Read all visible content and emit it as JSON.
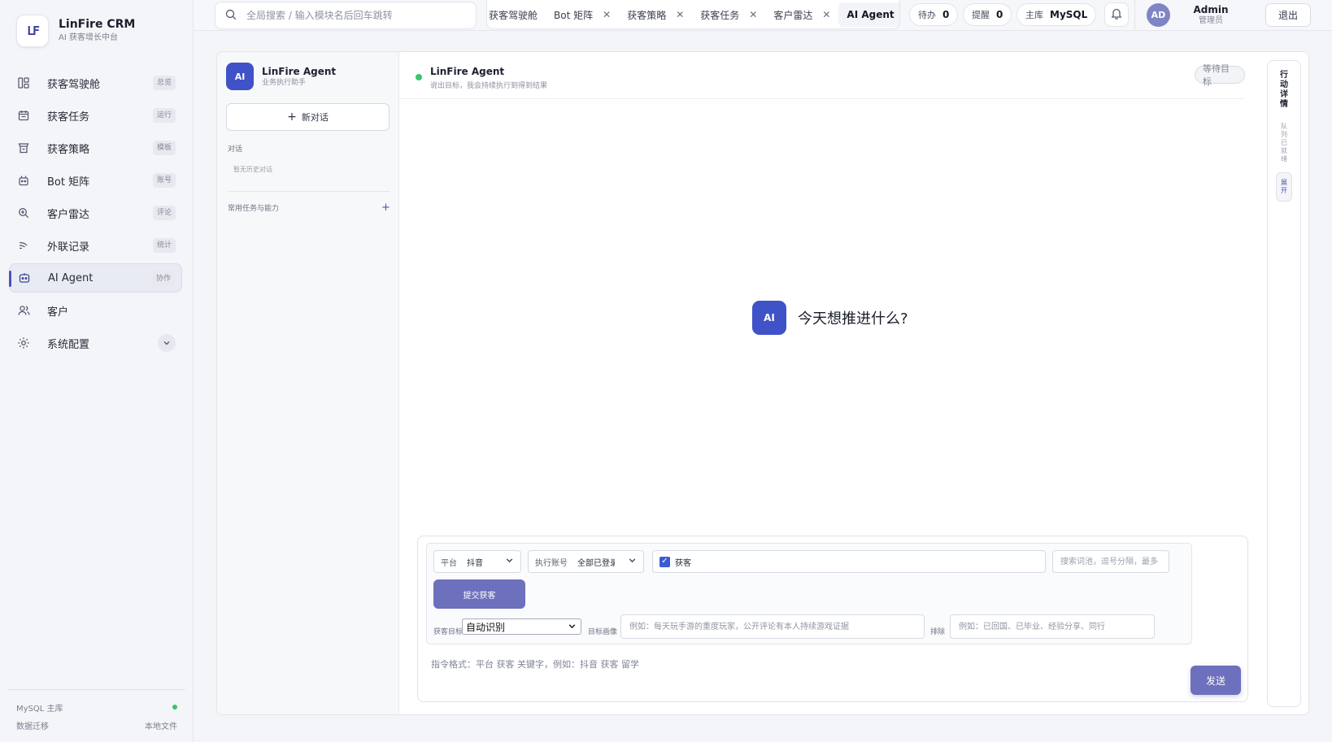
{
  "brand": {
    "title": "LinFire CRM",
    "subtitle": "AI 获客增长中台",
    "logo_text": "LF"
  },
  "sidebar": {
    "items": [
      {
        "label": "获客驾驶舱",
        "badge": "总览",
        "icon": "dashboard-icon"
      },
      {
        "label": "获客任务",
        "badge": "运行",
        "icon": "calendar-icon"
      },
      {
        "label": "获客策略",
        "badge": "模板",
        "icon": "filter-icon"
      },
      {
        "label": "Bot 矩阵",
        "badge": "账号",
        "icon": "bot-icon"
      },
      {
        "label": "客户雷达",
        "badge": "评论",
        "icon": "radar-search-icon"
      },
      {
        "label": "外联记录",
        "badge": "统计",
        "icon": "outreach-icon"
      },
      {
        "label": "AI Agent",
        "badge": "协作",
        "icon": "robot-icon",
        "active": true
      },
      {
        "label": "客户",
        "badge": "",
        "icon": "users-icon"
      }
    ],
    "config": {
      "label": "系统配置",
      "icon": "gear-icon"
    },
    "footer": {
      "db_label": "MySQL 主库",
      "migrate_label": "数据迁移",
      "local_label": "本地文件",
      "status_color": "#36c46a"
    }
  },
  "topbar": {
    "search_placeholder": "全局搜索 / 输入模块名后回车跳转",
    "tabs": [
      {
        "label": "获客驾驶舱",
        "closable": false
      },
      {
        "label": "Bot 矩阵",
        "closable": true
      },
      {
        "label": "获客策略",
        "closable": true
      },
      {
        "label": "获客任务",
        "closable": true
      },
      {
        "label": "客户雷达",
        "closable": true
      },
      {
        "label": "AI Agent",
        "closable": true,
        "active": true
      }
    ],
    "todo": {
      "label": "待办",
      "count": "0"
    },
    "remind": {
      "label": "提醒",
      "count": "0"
    },
    "db": {
      "label": "主库",
      "value": "MySQL"
    },
    "user": {
      "avatar": "AD",
      "name": "Admin",
      "role": "管理员"
    },
    "logout_label": "退出"
  },
  "conversations": {
    "agent_name": "LinFire Agent",
    "agent_sub": "业务执行助手",
    "ai_badge": "AI",
    "new_label": "新对话",
    "section_label": "对话",
    "empty_hint": "暂无历史对话",
    "capabilities_label": "常用任务与能力"
  },
  "chat": {
    "title": "LinFire Agent",
    "subtitle": "说出目标，我会持续执行到得到结果",
    "status": "等待目标",
    "hero_badge": "AI",
    "hero_text": "今天想推进什么?"
  },
  "composer": {
    "platform": {
      "label": "平台",
      "value": "抖音"
    },
    "account": {
      "label": "执行账号",
      "value": "全部已登录"
    },
    "mode_label": "获客",
    "mode_checked": true,
    "keyword_placeholder": "搜索词池，逗号分隔，最多",
    "submit_label": "提交获客",
    "goal": {
      "label": "获客目标",
      "value": "自动识别"
    },
    "persona": {
      "label": "目标画像",
      "placeholder": "例如：每天玩手游的重度玩家，公开评论有本人持续游戏证据"
    },
    "exclude": {
      "label": "排除",
      "placeholder": "例如：已回国、已毕业、经验分享、同行"
    },
    "command_placeholder": "指令格式：平台 获客 关键字，例如：抖音 获客 留学",
    "send_label": "发送"
  },
  "rail": {
    "title": "行动详情",
    "sub": "队列已就绪",
    "expand": "展开"
  },
  "colors": {
    "accent": "#3f52c8",
    "button": "#6d70bd",
    "online": "#3cc56f"
  }
}
